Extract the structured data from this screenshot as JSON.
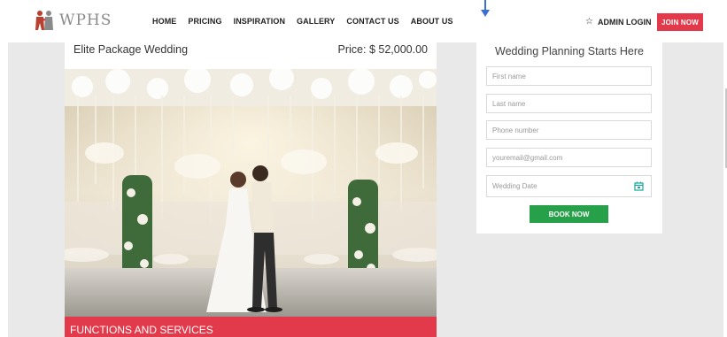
{
  "header": {
    "logo_text": "WPHS",
    "nav": [
      "HOME",
      "PRICING",
      "INSPIRATION",
      "GALLERY",
      "CONTACT US",
      "ABOUT US"
    ],
    "admin_login": "ADMIN LOGIN",
    "join_now": "JOIN NOW"
  },
  "package": {
    "title": "Elite Package Wedding",
    "price": "Price: $ 52,000.00",
    "section_title": "FUNCTIONS AND SERVICES"
  },
  "form": {
    "title": "Wedding Planning Starts Here",
    "first_name_placeholder": "First name",
    "last_name_placeholder": "Last name",
    "phone_placeholder": "Phone number",
    "email_placeholder": "youremail@gmail.com",
    "date_placeholder": "Wedding Date",
    "book_now": "BOOK NOW"
  },
  "icons": {
    "logo": "couple-logo-icon",
    "admin": "star-icon",
    "calendar": "calendar-icon"
  },
  "colors": {
    "brand_red": "#e23a4a",
    "book_green": "#27a04a",
    "page_bg": "#e9e9e9",
    "calendar_teal": "#1aa39a"
  }
}
